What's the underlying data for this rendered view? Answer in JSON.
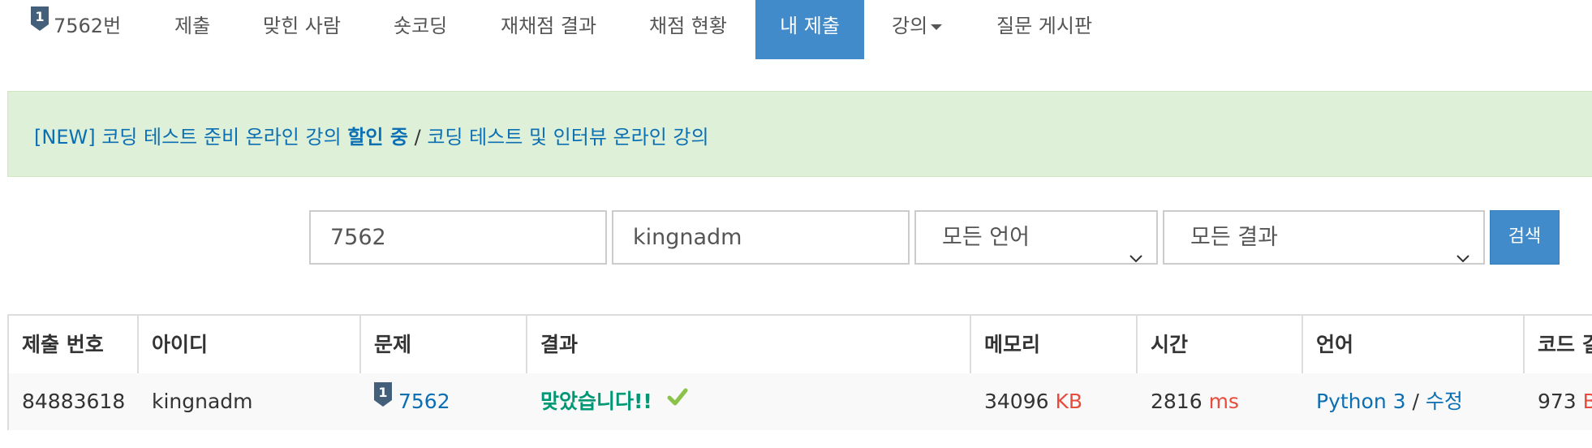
{
  "nav": {
    "problem_badge": "1",
    "items": [
      {
        "label": "7562번"
      },
      {
        "label": "제출"
      },
      {
        "label": "맞힌 사람"
      },
      {
        "label": "숏코딩"
      },
      {
        "label": "재채점 결과"
      },
      {
        "label": "채점 현황"
      },
      {
        "label": "내 제출",
        "active": true
      },
      {
        "label": "강의"
      },
      {
        "label": "질문 게시판"
      }
    ]
  },
  "banner": {
    "link1": "[NEW] 코딩 테스트 준비 온라인 강의",
    "highlight": "할인 중",
    "separator": "/",
    "link2": "코딩 테스트 및 인터뷰 온라인 강의"
  },
  "search": {
    "problem_value": "7562",
    "user_value": "kingnadm",
    "language_selected": "모든 언어",
    "result_selected": "모든 결과",
    "button_label": "검색"
  },
  "table": {
    "headers": [
      "제출 번호",
      "아이디",
      "문제",
      "결과",
      "메모리",
      "시간",
      "언어",
      "코드 길"
    ],
    "row": {
      "submission_id": "84883618",
      "user_id": "kingnadm",
      "problem_badge": "1",
      "problem": "7562",
      "result": "맞았습니다!!",
      "memory": "34096",
      "memory_unit": "KB",
      "time": "2816",
      "time_unit": "ms",
      "language": "Python 3",
      "language_sep": "/",
      "edit": "수정",
      "code_length": "973",
      "code_length_unit": "B"
    }
  },
  "colors": {
    "accent": "#428bca",
    "link": "#0b6fb4",
    "success": "#009874",
    "unit_red": "#e74c3c",
    "banner_bg": "#dff0d8"
  },
  "icons": {
    "problem_tier": "tier-badge-icon",
    "accepted": "check-icon",
    "dropdown": "chevron-down-icon",
    "menu_caret": "caret-down-icon"
  }
}
